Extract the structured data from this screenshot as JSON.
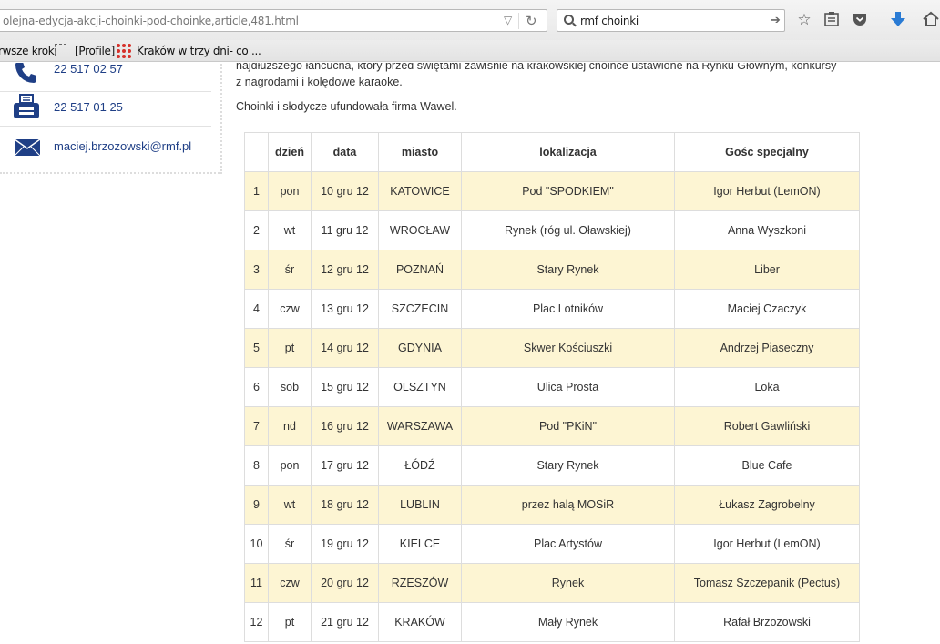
{
  "browser": {
    "url": "olejna-edycja-akcji-choinki-pod-choinke,article,481.html",
    "search_query": "rmf choinki",
    "bookmarks": [
      "rwsze kroki",
      "[Profile]",
      "Kraków w trzy dni- co ..."
    ]
  },
  "contact": {
    "phone": "22 517 02 57",
    "fax": "22 517 01 25",
    "email": "maciej.brzozowski@rmf.pl"
  },
  "article": {
    "paragraph1_line1": "najdłuższego łańcucha, który przed świętami zawiśnie na krakowskiej choince ustawione na Rynku Głównym, konkursy",
    "paragraph1_line2": "z nagrodami i kolędowe karaoke.",
    "paragraph2": "Choinki i słodycze ufundowała firma  Wawel."
  },
  "table": {
    "headers": [
      "",
      "dzień",
      "data",
      "miasto",
      "lokalizacja",
      "Gośc specjalny"
    ],
    "rows": [
      [
        "1",
        "pon",
        "10 gru 12",
        "KATOWICE",
        "Pod \"SPODKIEM\"",
        "Igor Herbut (LemON)"
      ],
      [
        "2",
        "wt",
        "11 gru 12",
        "WROCŁAW",
        "Rynek (róg ul. Oławskiej)",
        "Anna Wyszkoni"
      ],
      [
        "3",
        "śr",
        "12 gru 12",
        "POZNAŃ",
        "Stary Rynek",
        "Liber"
      ],
      [
        "4",
        "czw",
        "13 gru 12",
        "SZCZECIN",
        "Plac Lotników",
        "Maciej Czaczyk"
      ],
      [
        "5",
        "pt",
        "14 gru 12",
        "GDYNIA",
        "Skwer Kościuszki",
        "Andrzej Piaseczny"
      ],
      [
        "6",
        "sob",
        "15 gru 12",
        "OLSZTYN",
        "Ulica Prosta",
        "Loka"
      ],
      [
        "7",
        "nd",
        "16 gru 12",
        "WARSZAWA",
        "Pod \"PKiN\"",
        "Robert Gawliński"
      ],
      [
        "8",
        "pon",
        "17 gru 12",
        "ŁÓDŹ",
        "Stary Rynek",
        "Blue Cafe"
      ],
      [
        "9",
        "wt",
        "18 gru 12",
        "LUBLIN",
        "przez halą MOSiR",
        "Łukasz Zagrobelny"
      ],
      [
        "10",
        "śr",
        "19 gru 12",
        "KIELCE",
        "Plac Artystów",
        "Igor Herbut (LemON)"
      ],
      [
        "11",
        "czw",
        "20 gru 12",
        "RZESZÓW",
        "Rynek",
        "Tomasz Szczepanik (Pectus)"
      ],
      [
        "12",
        "pt",
        "21 gru 12",
        "KRAKÓW",
        "Mały Rynek",
        "Rafał Brzozowski"
      ]
    ]
  },
  "colors": {
    "link_blue": "#1f3f86",
    "row_highlight": "#fdf5d3"
  }
}
